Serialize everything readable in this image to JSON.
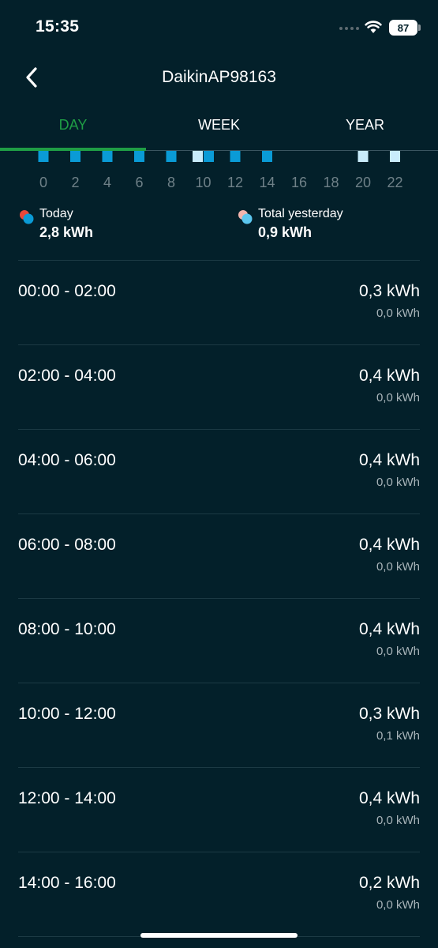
{
  "status_bar": {
    "time": "15:35",
    "battery": "87"
  },
  "header": {
    "back_icon": "chevron-left-icon",
    "title": "DaikinAP98163"
  },
  "tabs": [
    {
      "label": "DAY",
      "active": true
    },
    {
      "label": "WEEK",
      "active": false
    },
    {
      "label": "YEAR",
      "active": false
    }
  ],
  "colors": {
    "accent": "#1f9e45",
    "background": "#03202a",
    "bar_today": "#0a9bd6",
    "bar_yesterday": "#c9ecfb"
  },
  "chart_data": {
    "type": "bar",
    "x_tick_labels": [
      "0",
      "2",
      "4",
      "6",
      "8",
      "10",
      "12",
      "14",
      "16",
      "18",
      "20",
      "22"
    ],
    "categories": [
      "0",
      "2",
      "4",
      "6",
      "8",
      "10",
      "12",
      "14",
      "16",
      "18",
      "20",
      "22"
    ],
    "series": [
      {
        "name": "Today",
        "values": [
          0.3,
          0.4,
          0.4,
          0.4,
          0.4,
          0.3,
          0.4,
          0.2,
          0,
          0,
          0,
          0
        ]
      },
      {
        "name": "Total yesterday",
        "values": [
          0.0,
          0.0,
          0.0,
          0.0,
          0.0,
          0.1,
          0.0,
          0.0,
          0,
          0,
          0.4,
          0.4
        ]
      }
    ],
    "ylabel": "",
    "xlabel": ""
  },
  "legend": {
    "today_label": "Today",
    "today_value": "2,8 kWh",
    "yesterday_label": "Total yesterday",
    "yesterday_value": "0,9 kWh"
  },
  "rows": [
    {
      "time": "00:00 - 02:00",
      "today": "0,3 kWh",
      "yesterday": "0,0 kWh"
    },
    {
      "time": "02:00 - 04:00",
      "today": "0,4 kWh",
      "yesterday": "0,0 kWh"
    },
    {
      "time": "04:00 - 06:00",
      "today": "0,4 kWh",
      "yesterday": "0,0 kWh"
    },
    {
      "time": "06:00 - 08:00",
      "today": "0,4 kWh",
      "yesterday": "0,0 kWh"
    },
    {
      "time": "08:00 - 10:00",
      "today": "0,4 kWh",
      "yesterday": "0,0 kWh"
    },
    {
      "time": "10:00 - 12:00",
      "today": "0,3 kWh",
      "yesterday": "0,1 kWh"
    },
    {
      "time": "12:00 - 14:00",
      "today": "0,4 kWh",
      "yesterday": "0,0 kWh"
    },
    {
      "time": "14:00 - 16:00",
      "today": "0,2 kWh",
      "yesterday": "0,0 kWh"
    }
  ]
}
